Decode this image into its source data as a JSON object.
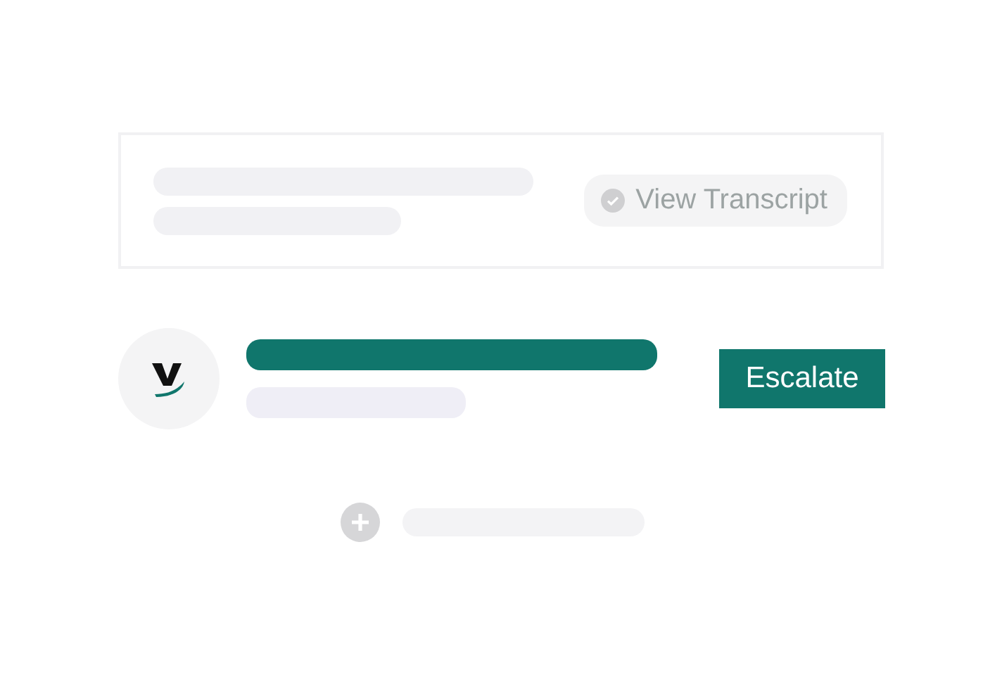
{
  "transcript_card": {
    "button": {
      "label": "View Transcript"
    }
  },
  "escalation_row": {
    "button": {
      "label": "Escalate"
    }
  }
}
